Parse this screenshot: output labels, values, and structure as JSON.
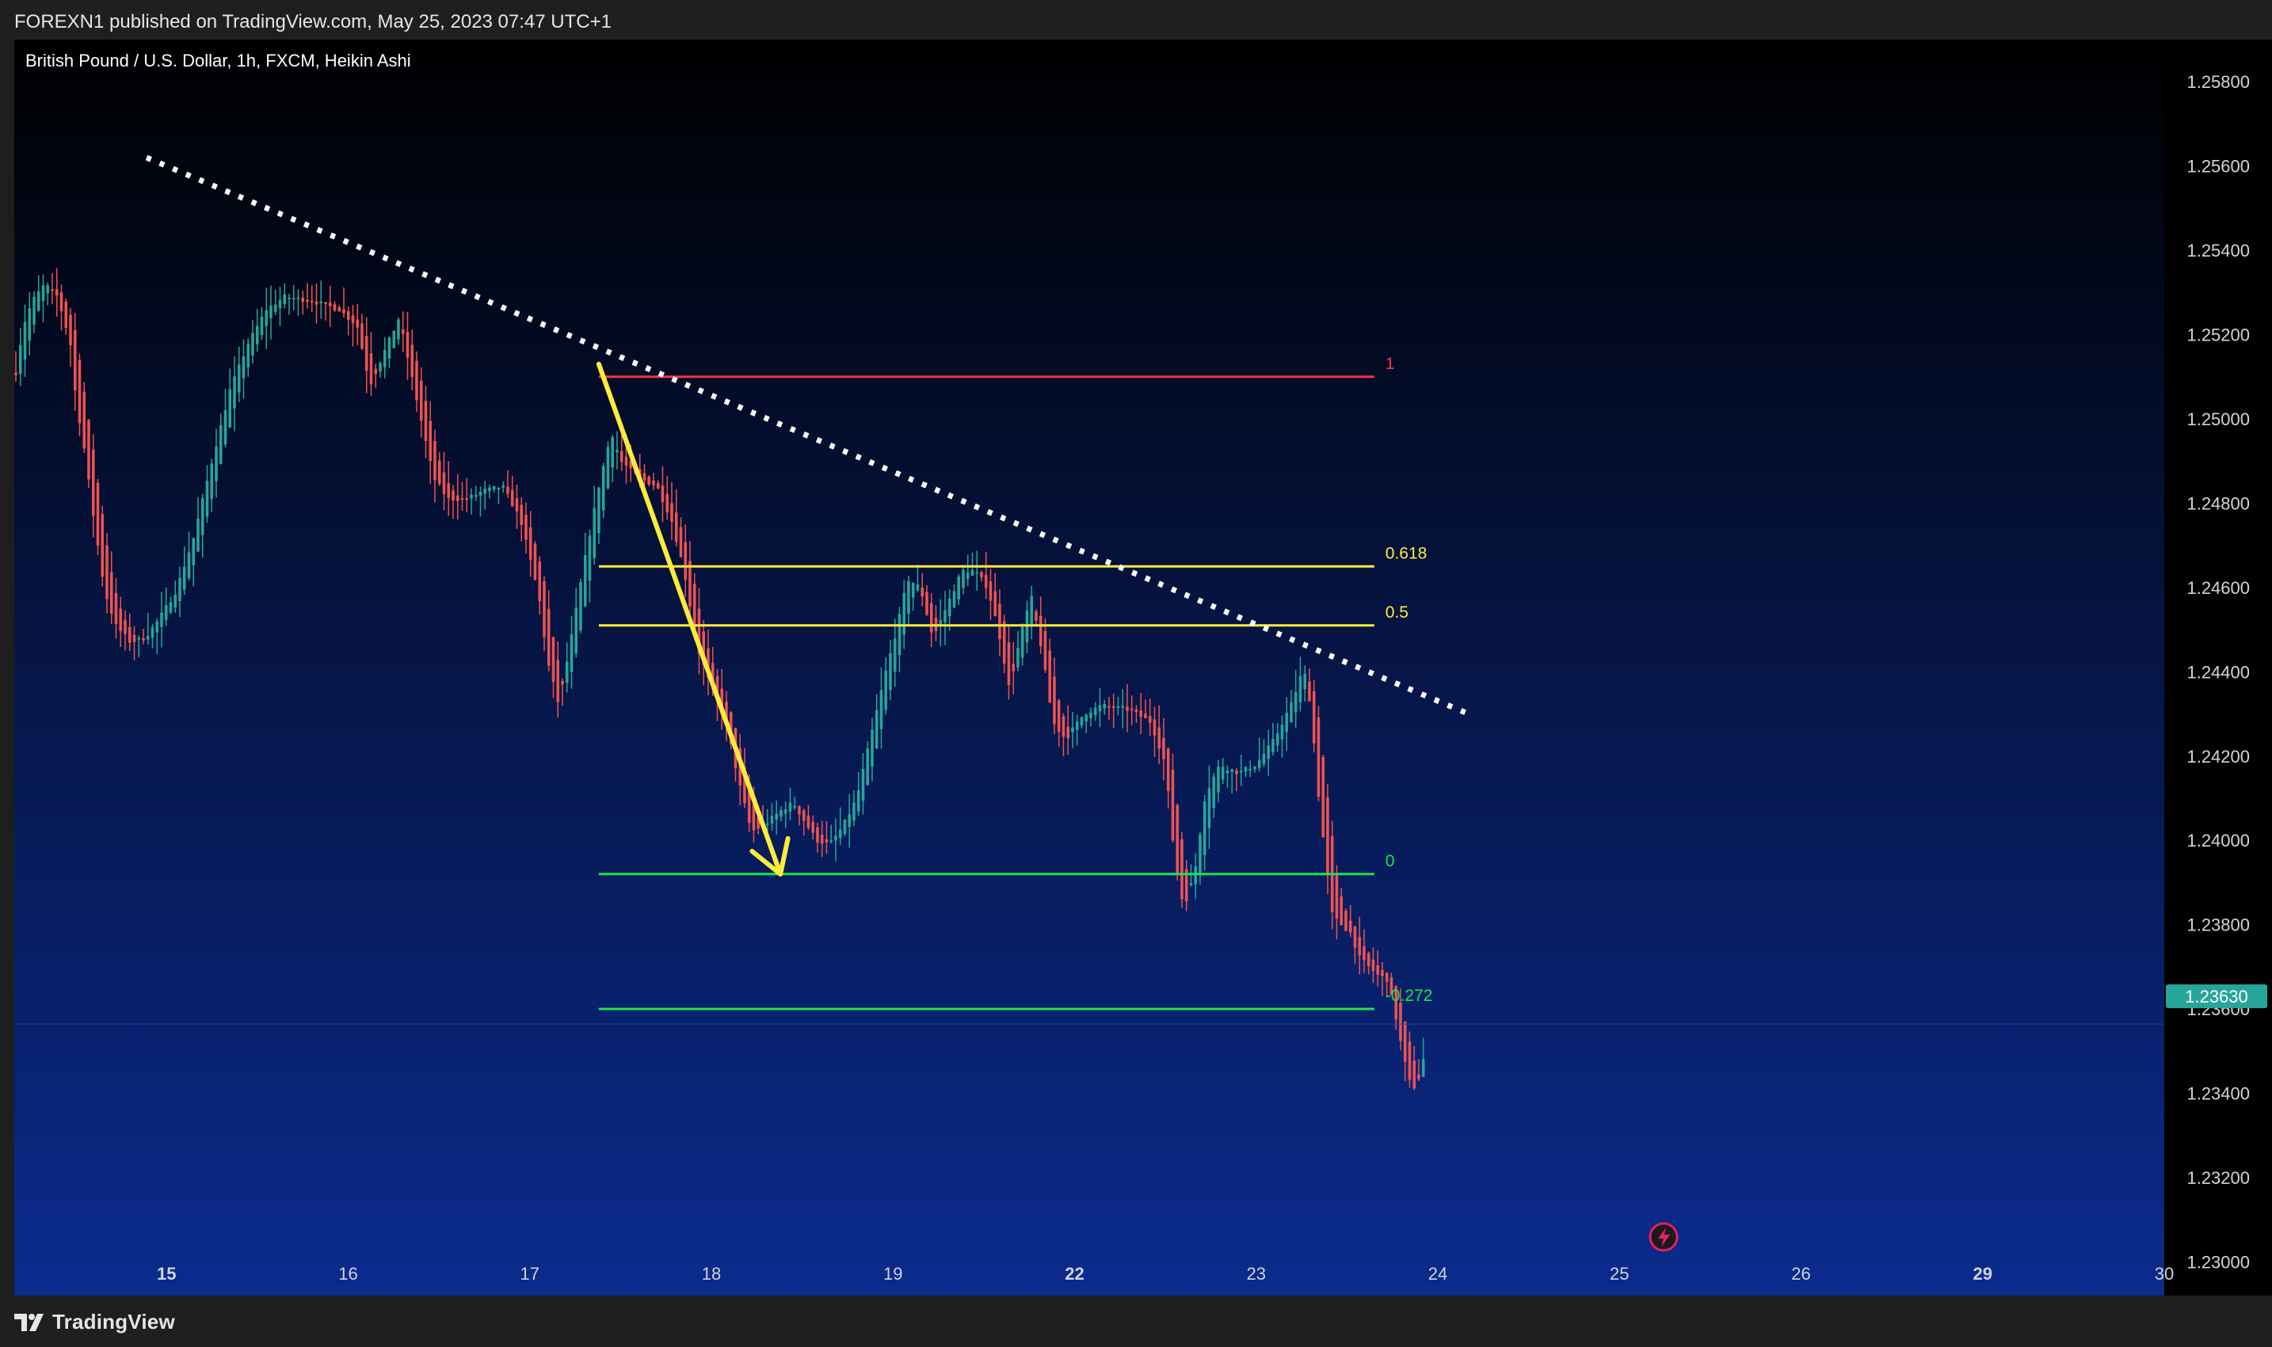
{
  "header": {
    "publish_info": "FOREXN1 published on TradingView.com, May 25, 2023 07:47 UTC+1"
  },
  "footer": {
    "brand": "TradingView",
    "brand_icon": "tradingview-logo-icon"
  },
  "colors": {
    "bg_top": "#000000",
    "bg_bottom": "#0b2b8e",
    "up_candle": "#26a69a",
    "down_candle": "#ef5350",
    "trendline": "#ffffff",
    "arrow": "#ffeb3b",
    "fib_1": "#f23645",
    "fib_618": "#ffeb3b",
    "fib_05": "#ffeb3b",
    "fib_0": "#1ee34a",
    "fib_neg272": "#1ee34a",
    "price_tag": "#26a69a"
  },
  "chart_data": {
    "type": "candlestick",
    "title": "British Pound / U.S. Dollar, 1h, FXCM, Heikin Ashi",
    "ylim": [
      1.2292,
      1.259
    ],
    "y_ticks": [
      "1.25800",
      "1.25600",
      "1.25400",
      "1.25200",
      "1.25000",
      "1.24800",
      "1.24600",
      "1.24400",
      "1.24200",
      "1.24000",
      "1.23800",
      "1.23600",
      "1.23400",
      "1.23200",
      "1.23000"
    ],
    "x_ticks": [
      {
        "label": "15",
        "pos": 0.5,
        "bold": true
      },
      {
        "label": "16",
        "pos": 1.5,
        "bold": false
      },
      {
        "label": "17",
        "pos": 2.5,
        "bold": false
      },
      {
        "label": "18",
        "pos": 3.5,
        "bold": false
      },
      {
        "label": "19",
        "pos": 4.5,
        "bold": false
      },
      {
        "label": "22",
        "pos": 5.5,
        "bold": true
      },
      {
        "label": "23",
        "pos": 6.5,
        "bold": false
      },
      {
        "label": "24",
        "pos": 7.5,
        "bold": false
      },
      {
        "label": "25",
        "pos": 8.5,
        "bold": false
      },
      {
        "label": "26",
        "pos": 9.5,
        "bold": false
      },
      {
        "label": "29",
        "pos": 10.5,
        "bold": true
      },
      {
        "label": "30",
        "pos": 11.5,
        "bold": false
      }
    ],
    "x_domain": [
      -0.33,
      11.5
    ],
    "last_price": "1.23630",
    "last_price_value": 1.2363,
    "trend_path": [
      {
        "t": -0.33,
        "v": 1.2511
      },
      {
        "t": -0.29,
        "v": 1.2522
      },
      {
        "t": -0.24,
        "v": 1.2528
      },
      {
        "t": -0.17,
        "v": 1.2532
      },
      {
        "t": -0.1,
        "v": 1.2529
      },
      {
        "t": -0.03,
        "v": 1.2518
      },
      {
        "t": 0.0,
        "v": 1.2505
      },
      {
        "t": 0.05,
        "v": 1.2492
      },
      {
        "t": 0.1,
        "v": 1.2476
      },
      {
        "t": 0.16,
        "v": 1.2459
      },
      {
        "t": 0.22,
        "v": 1.2451
      },
      {
        "t": 0.3,
        "v": 1.2447
      },
      {
        "t": 0.38,
        "v": 1.2448
      },
      {
        "t": 0.45,
        "v": 1.2452
      },
      {
        "t": 0.55,
        "v": 1.2459
      },
      {
        "t": 0.65,
        "v": 1.2472
      },
      {
        "t": 0.75,
        "v": 1.249
      },
      {
        "t": 0.85,
        "v": 1.2507
      },
      {
        "t": 0.95,
        "v": 1.2518
      },
      {
        "t": 1.05,
        "v": 1.2526
      },
      {
        "t": 1.15,
        "v": 1.2529
      },
      {
        "t": 1.3,
        "v": 1.2528
      },
      {
        "t": 1.45,
        "v": 1.2526
      },
      {
        "t": 1.55,
        "v": 1.2522
      },
      {
        "t": 1.62,
        "v": 1.2508
      },
      {
        "t": 1.7,
        "v": 1.2516
      },
      {
        "t": 1.78,
        "v": 1.2524
      },
      {
        "t": 1.83,
        "v": 1.2514
      },
      {
        "t": 1.9,
        "v": 1.25
      },
      {
        "t": 1.97,
        "v": 1.2486
      },
      {
        "t": 2.05,
        "v": 1.2481
      },
      {
        "t": 2.15,
        "v": 1.2481
      },
      {
        "t": 2.25,
        "v": 1.2483
      },
      {
        "t": 2.35,
        "v": 1.2484
      },
      {
        "t": 2.45,
        "v": 1.2476
      },
      {
        "t": 2.55,
        "v": 1.2458
      },
      {
        "t": 2.6,
        "v": 1.2442
      },
      {
        "t": 2.66,
        "v": 1.2432
      },
      {
        "t": 2.72,
        "v": 1.2446
      },
      {
        "t": 2.8,
        "v": 1.2466
      },
      {
        "t": 2.88,
        "v": 1.2484
      },
      {
        "t": 2.95,
        "v": 1.2497
      },
      {
        "t": 3.0,
        "v": 1.249
      },
      {
        "t": 3.1,
        "v": 1.2486
      },
      {
        "t": 3.2,
        "v": 1.2484
      },
      {
        "t": 3.28,
        "v": 1.2476
      },
      {
        "t": 3.35,
        "v": 1.2464
      },
      {
        "t": 3.42,
        "v": 1.2446
      },
      {
        "t": 3.5,
        "v": 1.2436
      },
      {
        "t": 3.58,
        "v": 1.2428
      },
      {
        "t": 3.65,
        "v": 1.2414
      },
      {
        "t": 3.72,
        "v": 1.2402
      },
      {
        "t": 3.8,
        "v": 1.2404
      },
      {
        "t": 3.88,
        "v": 1.2407
      },
      {
        "t": 3.95,
        "v": 1.2409
      },
      {
        "t": 4.02,
        "v": 1.2404
      },
      {
        "t": 4.08,
        "v": 1.24
      },
      {
        "t": 4.15,
        "v": 1.2399
      },
      {
        "t": 4.22,
        "v": 1.2403
      },
      {
        "t": 4.3,
        "v": 1.241
      },
      {
        "t": 4.38,
        "v": 1.2425
      },
      {
        "t": 4.46,
        "v": 1.244
      },
      {
        "t": 4.52,
        "v": 1.245
      },
      {
        "t": 4.58,
        "v": 1.2462
      },
      {
        "t": 4.65,
        "v": 1.246
      },
      {
        "t": 4.72,
        "v": 1.2448
      },
      {
        "t": 4.8,
        "v": 1.2456
      },
      {
        "t": 4.88,
        "v": 1.2464
      },
      {
        "t": 4.95,
        "v": 1.2464
      },
      {
        "t": 5.02,
        "v": 1.246
      },
      {
        "t": 5.08,
        "v": 1.245
      },
      {
        "t": 5.14,
        "v": 1.2436
      },
      {
        "t": 5.2,
        "v": 1.2448
      },
      {
        "t": 5.26,
        "v": 1.2458
      },
      {
        "t": 5.32,
        "v": 1.2445
      },
      {
        "t": 5.38,
        "v": 1.2428
      },
      {
        "t": 5.45,
        "v": 1.2424
      },
      {
        "t": 5.55,
        "v": 1.243
      },
      {
        "t": 5.65,
        "v": 1.2432
      },
      {
        "t": 5.8,
        "v": 1.2431
      },
      {
        "t": 5.92,
        "v": 1.2428
      },
      {
        "t": 6.0,
        "v": 1.2418
      },
      {
        "t": 6.05,
        "v": 1.2396
      },
      {
        "t": 6.1,
        "v": 1.2384
      },
      {
        "t": 6.16,
        "v": 1.2392
      },
      {
        "t": 6.22,
        "v": 1.2411
      },
      {
        "t": 6.3,
        "v": 1.2418
      },
      {
        "t": 6.4,
        "v": 1.2416
      },
      {
        "t": 6.5,
        "v": 1.2418
      },
      {
        "t": 6.6,
        "v": 1.2424
      },
      {
        "t": 6.7,
        "v": 1.2433
      },
      {
        "t": 6.76,
        "v": 1.2441
      },
      {
        "t": 6.8,
        "v": 1.2432
      },
      {
        "t": 6.84,
        "v": 1.2412
      },
      {
        "t": 6.88,
        "v": 1.2396
      },
      {
        "t": 6.92,
        "v": 1.2382
      },
      {
        "t": 6.97,
        "v": 1.238
      },
      {
        "t": 7.02,
        "v": 1.2378
      },
      {
        "t": 7.07,
        "v": 1.2372
      },
      {
        "t": 7.12,
        "v": 1.237
      },
      {
        "t": 7.17,
        "v": 1.2368
      },
      {
        "t": 7.22,
        "v": 1.2367
      },
      {
        "t": 7.26,
        "v": 1.236
      },
      {
        "t": 7.3,
        "v": 1.2351
      },
      {
        "t": 7.34,
        "v": 1.2343
      },
      {
        "t": 7.38,
        "v": 1.2341
      },
      {
        "t": 7.42,
        "v": 1.2348
      }
    ],
    "fib_levels": [
      {
        "label": "1",
        "value": 1.251,
        "color": "#f23645"
      },
      {
        "label": "0.618",
        "value": 1.2465,
        "color": "#ffeb3b"
      },
      {
        "label": "0.5",
        "value": 1.2451,
        "color": "#ffeb3b"
      },
      {
        "label": "0",
        "value": 1.2392,
        "color": "#1ee34a"
      },
      {
        "label": "-0.272",
        "value": 1.236,
        "color": "#1ee34a"
      }
    ],
    "fib_x_range": [
      2.88,
      7.15
    ],
    "trendline": {
      "from": {
        "t": 0.39,
        "v": 1.2562
      },
      "to": {
        "t": 7.67,
        "v": 1.243
      }
    },
    "arrow": {
      "from": {
        "t": 2.88,
        "v": 1.2513
      },
      "to": {
        "t": 3.88,
        "v": 1.2392
      }
    },
    "candle_count": 310
  }
}
